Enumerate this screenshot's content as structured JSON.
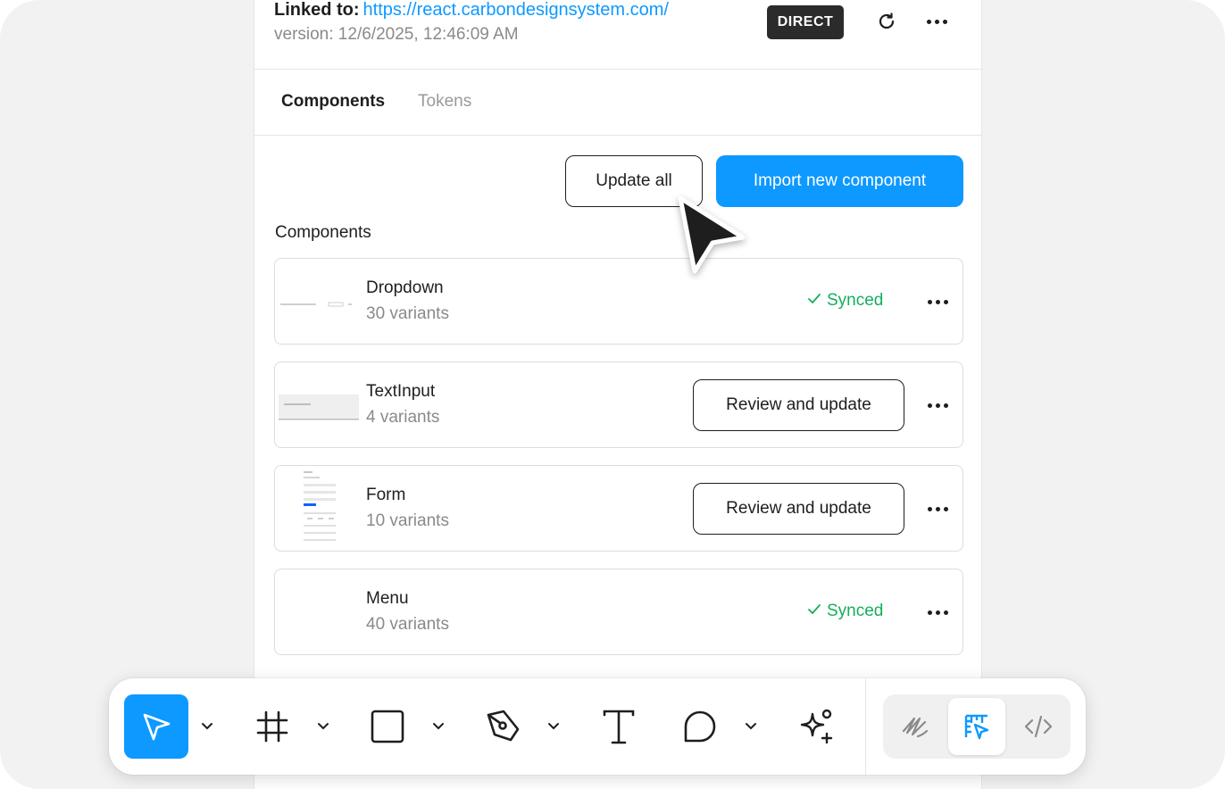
{
  "header": {
    "linked_label": "Linked to:",
    "linked_url": "https://react.carbondesignsystem.com/",
    "version": "version: 12/6/2025, 12:46:09 AM",
    "badge": "DIRECT",
    "icons": [
      "refresh-icon",
      "more-icon"
    ]
  },
  "tabs": [
    {
      "label": "Components",
      "active": true
    },
    {
      "label": "Tokens",
      "active": false
    }
  ],
  "actions": {
    "update_all": "Update all",
    "import_new": "Import new component"
  },
  "section_label": "Components",
  "components": [
    {
      "name": "Dropdown",
      "variants": "30 variants",
      "status": "synced",
      "status_label": "Synced"
    },
    {
      "name": "TextInput",
      "variants": "4 variants",
      "status": "needs-update",
      "action_label": "Review and update"
    },
    {
      "name": "Form",
      "variants": "10 variants",
      "status": "needs-update",
      "action_label": "Review and update"
    },
    {
      "name": "Menu",
      "variants": "40 variants",
      "status": "synced",
      "status_label": "Synced"
    }
  ],
  "toolbar": {
    "tools": [
      "move-tool",
      "frame-tool",
      "rectangle-tool",
      "pen-tool",
      "text-tool",
      "comment-tool",
      "ai-tool"
    ],
    "active_tool": "move-tool",
    "modes": [
      "draw-mode",
      "design-mode",
      "dev-mode"
    ],
    "active_mode": "design-mode"
  },
  "colors": {
    "accent": "#0d99ff",
    "synced": "#14ae5c",
    "badge_bg": "#2b2b2b",
    "text": "#1e1e1e",
    "muted": "#8a8a8a"
  }
}
